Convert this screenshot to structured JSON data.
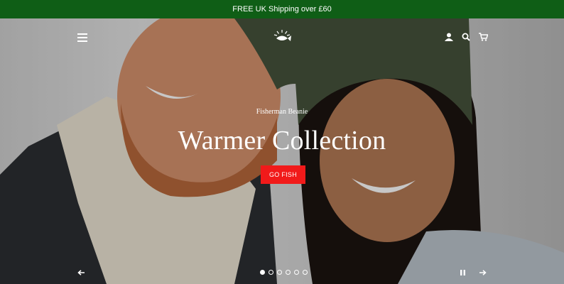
{
  "announcement": {
    "text": "FREE UK Shipping over £60"
  },
  "header": {
    "menu_icon": "hamburger-menu-icon",
    "logo_icon": "sun-fish-logo-icon",
    "account_icon": "account-icon",
    "search_icon": "search-icon",
    "cart_icon": "cart-icon"
  },
  "slideshow": {
    "subheading": "Fisherman Beanie",
    "heading": "Warmer Collection",
    "button_label": "GO FISH",
    "slide_count": 6,
    "active_slide": 1,
    "controls": {
      "prev_icon": "arrow-left-icon",
      "next_icon": "arrow-right-icon",
      "pause_icon": "pause-icon"
    }
  },
  "colors": {
    "announcement_bg": "#0f5e16",
    "button_bg": "#f11a1a",
    "beanie": "#46523c"
  }
}
